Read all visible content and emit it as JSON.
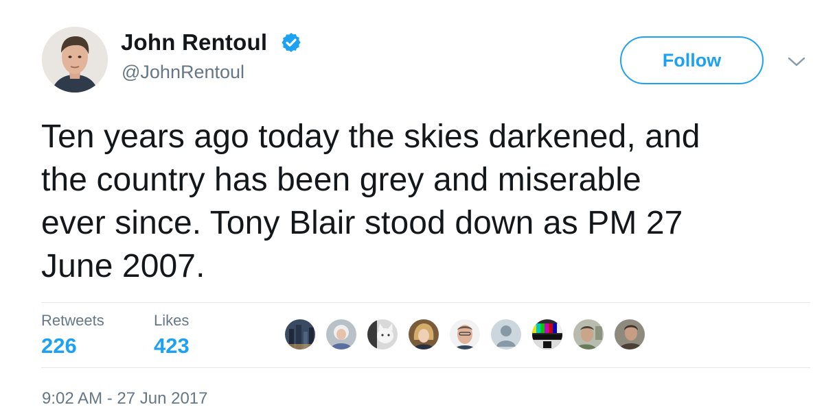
{
  "author": {
    "display_name": "John Rentoul",
    "handle": "@JohnRentoul",
    "verified": true,
    "avatar_icon": "profile-photo"
  },
  "follow_button": {
    "label": "Follow"
  },
  "menu": {
    "icon": "chevron-down-icon"
  },
  "tweet": {
    "lines": [
      "Ten years ago today the skies darkened, and",
      "the country has been grey and miserable",
      "ever since. Tony Blair stood down as PM 27",
      "June 2007."
    ]
  },
  "stats": {
    "retweets_label": "Retweets",
    "retweets_count": "226",
    "likes_label": "Likes",
    "likes_count": "423"
  },
  "likers": [
    {
      "name": "liker-avatar-1",
      "color": "#3a4a63"
    },
    {
      "name": "liker-avatar-2",
      "color": "#b9c1c8"
    },
    {
      "name": "liker-avatar-3",
      "color": "#d9d9d9"
    },
    {
      "name": "liker-avatar-4",
      "color": "#c9a66b"
    },
    {
      "name": "liker-avatar-5",
      "color": "#e0c9b4"
    },
    {
      "name": "liker-avatar-6",
      "color": "#ccd6dd"
    },
    {
      "name": "liker-avatar-7",
      "color": "#2b2b2b"
    },
    {
      "name": "liker-avatar-8",
      "color": "#b7bcae"
    },
    {
      "name": "liker-avatar-9",
      "color": "#8f8a7e"
    }
  ],
  "timestamp": "9:02 AM - 27 Jun 2017",
  "colors": {
    "accent": "#1da1f2",
    "secondary_text": "#657786",
    "primary_text": "#14171a",
    "divider": "#e1e8ed"
  }
}
